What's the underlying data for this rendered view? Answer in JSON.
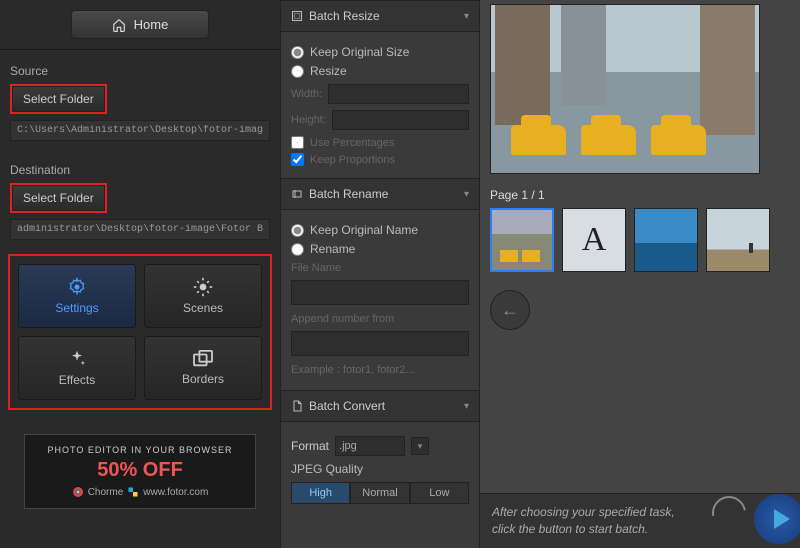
{
  "home_label": "Home",
  "source_label": "Source",
  "source_select_btn": "Select Folder",
  "source_path": "C:\\Users\\Administrator\\Desktop\\fotor-image",
  "dest_label": "Destination",
  "dest_select_btn": "Select Folder",
  "dest_path": "administrator\\Desktop\\fotor-image\\Fotor Batch",
  "tiles": {
    "settings": "Settings",
    "scenes": "Scenes",
    "effects": "Effects",
    "borders": "Borders"
  },
  "promo": {
    "line1": "PHOTO EDITOR IN YOUR BROWSER",
    "off": "50% OFF",
    "chorme": "Chorme",
    "site": "www.fotor.com"
  },
  "resize": {
    "title": "Batch Resize",
    "keep_original": "Keep Original Size",
    "resize": "Resize",
    "width": "Width:",
    "height": "Height:",
    "use_pct": "Use Percentages",
    "keep_prop": "Keep Proportions"
  },
  "rename": {
    "title": "Batch Rename",
    "keep_name": "Keep Original Name",
    "rename": "Rename",
    "file_name": "File Name",
    "append": "Append number from",
    "example": "Example : fotor1, fotor2..."
  },
  "convert": {
    "title": "Batch Convert",
    "format_label": "Format",
    "format_value": ".jpg",
    "quality_label": "JPEG Quality",
    "quality": {
      "high": "High",
      "normal": "Normal",
      "low": "Low"
    }
  },
  "page": "Page 1 / 1",
  "footer": {
    "line1": "After choosing your specified task,",
    "line2": "click the button to start batch."
  }
}
